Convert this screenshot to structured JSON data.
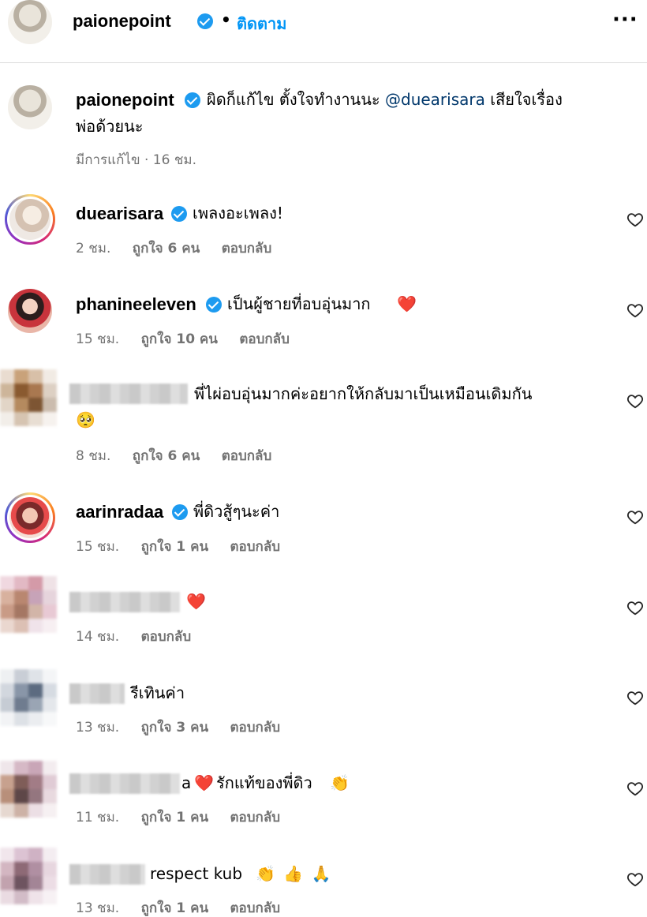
{
  "header": {
    "username": "paionepoint",
    "separator": "•",
    "follow_label": "ติดตาม",
    "more_label": "···"
  },
  "caption": {
    "username": "paionepoint",
    "text_part1": "ผิดก็แก้ไข ตั้งใจทำงานนะ",
    "mention": "@duearisara",
    "text_part2": "เสียใจเรื่อง",
    "text_line2": "พ่อด้วยนะ",
    "meta": "มีการแก้ไข · 16 ชม."
  },
  "comments": [
    {
      "username": "duearisara",
      "text": "เพลงอะเพลง!",
      "time": "2 ชม.",
      "likes": "ถูกใจ 6 คน",
      "reply": "ตอบกลับ"
    },
    {
      "username": "phanineeleven",
      "text": "เป็นผู้ชายที่อบอุ่นมาก",
      "emoji": "❤️",
      "time": "15 ชม.",
      "likes": "ถูกใจ 10 คน",
      "reply": "ตอบกลับ"
    },
    {
      "username": "",
      "text": "พี่ไผ่อบอุ่นมากค่ะอยากให้กลับมาเป็นเหมือนเดิมกัน",
      "emoji": "🥺",
      "time": "8 ชม.",
      "likes": "ถูกใจ 6 คน",
      "reply": "ตอบกลับ"
    },
    {
      "username": "aarinradaa",
      "text": "พี่ดิวสู้ๆนะค่า",
      "time": "15 ชม.",
      "likes": "ถูกใจ 1 คน",
      "reply": "ตอบกลับ"
    },
    {
      "username": "",
      "text": "",
      "emoji": "❤️",
      "time": "14 ชม.",
      "reply": "ตอบกลับ"
    },
    {
      "username": "",
      "text": "รีเทินค่า",
      "time": "13 ชม.",
      "likes": "ถูกใจ 3 คน",
      "reply": "ตอบกลับ"
    },
    {
      "username": "",
      "text_prefix": "a",
      "emoji": "❤️",
      "text": "รักแท้ของพี่ดิว",
      "emoji2": "👏",
      "time": "11 ชม.",
      "likes": "ถูกใจ 1 คน",
      "reply": "ตอบกลับ"
    },
    {
      "username": "",
      "text": "respect kub",
      "emoji": "👏 👍 🙏",
      "time": "13 ชม.",
      "likes": "ถูกใจ 1 คน",
      "reply": "ตอบกลับ"
    }
  ],
  "colors": {
    "link": "#0095f6",
    "verified": "#1d9bf0",
    "meta": "#737373",
    "heart": "#e0245e"
  }
}
